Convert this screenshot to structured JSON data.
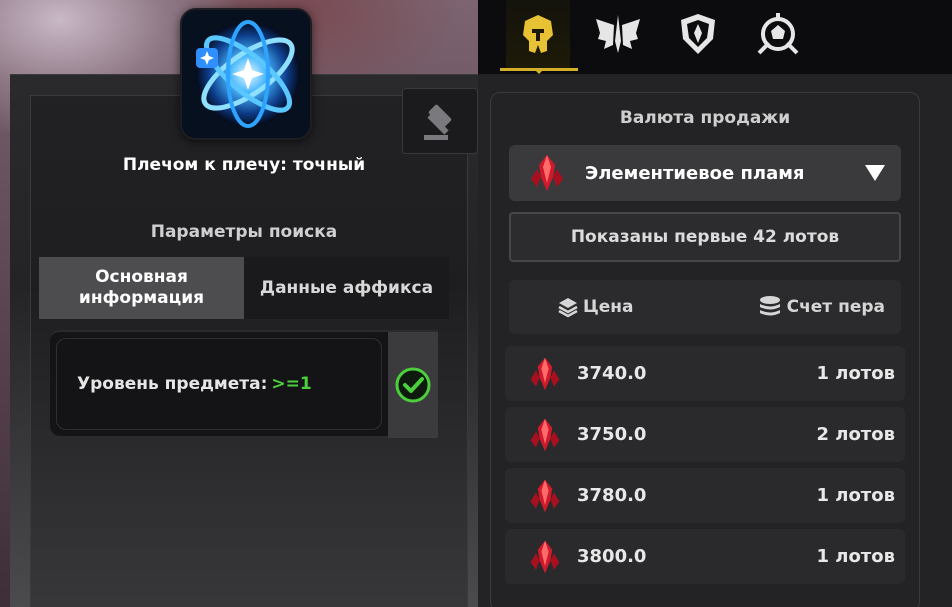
{
  "item": {
    "name": "Плечом к плечу: точный",
    "icon": "blue-orbit-skill-icon"
  },
  "nav": {
    "items": [
      {
        "icon": "gold-helmet-icon",
        "active": true
      },
      {
        "icon": "wings-sword-icon",
        "active": false
      },
      {
        "icon": "shield-emblem-icon",
        "active": false
      },
      {
        "icon": "crosshair-skull-icon",
        "active": false
      }
    ],
    "accent": "#d4b02a"
  },
  "search": {
    "title": "Параметры поиска",
    "tabs": [
      {
        "label": "Основная информация",
        "active": true
      },
      {
        "label": "Данные аффикса",
        "active": false
      }
    ],
    "filter": {
      "label": "Уровень предмета:",
      "value": ">=1",
      "checked": true
    }
  },
  "currency": {
    "title": "Валюта продажи",
    "selected": "Элементиевое пламя",
    "icon": "red-crystal-icon"
  },
  "results": {
    "shown_text": "Показаны первые 42 лотов",
    "header": {
      "price": "Цена",
      "count": "Счет пера"
    },
    "rows": [
      {
        "price": "3740.0",
        "lots": "1 лотов"
      },
      {
        "price": "3750.0",
        "lots": "2 лотов"
      },
      {
        "price": "3780.0",
        "lots": "1 лотов"
      },
      {
        "price": "3800.0",
        "lots": "1 лотов"
      }
    ]
  },
  "colors": {
    "check_green": "#4ccf3c",
    "gem_red": "#d01a2c"
  }
}
